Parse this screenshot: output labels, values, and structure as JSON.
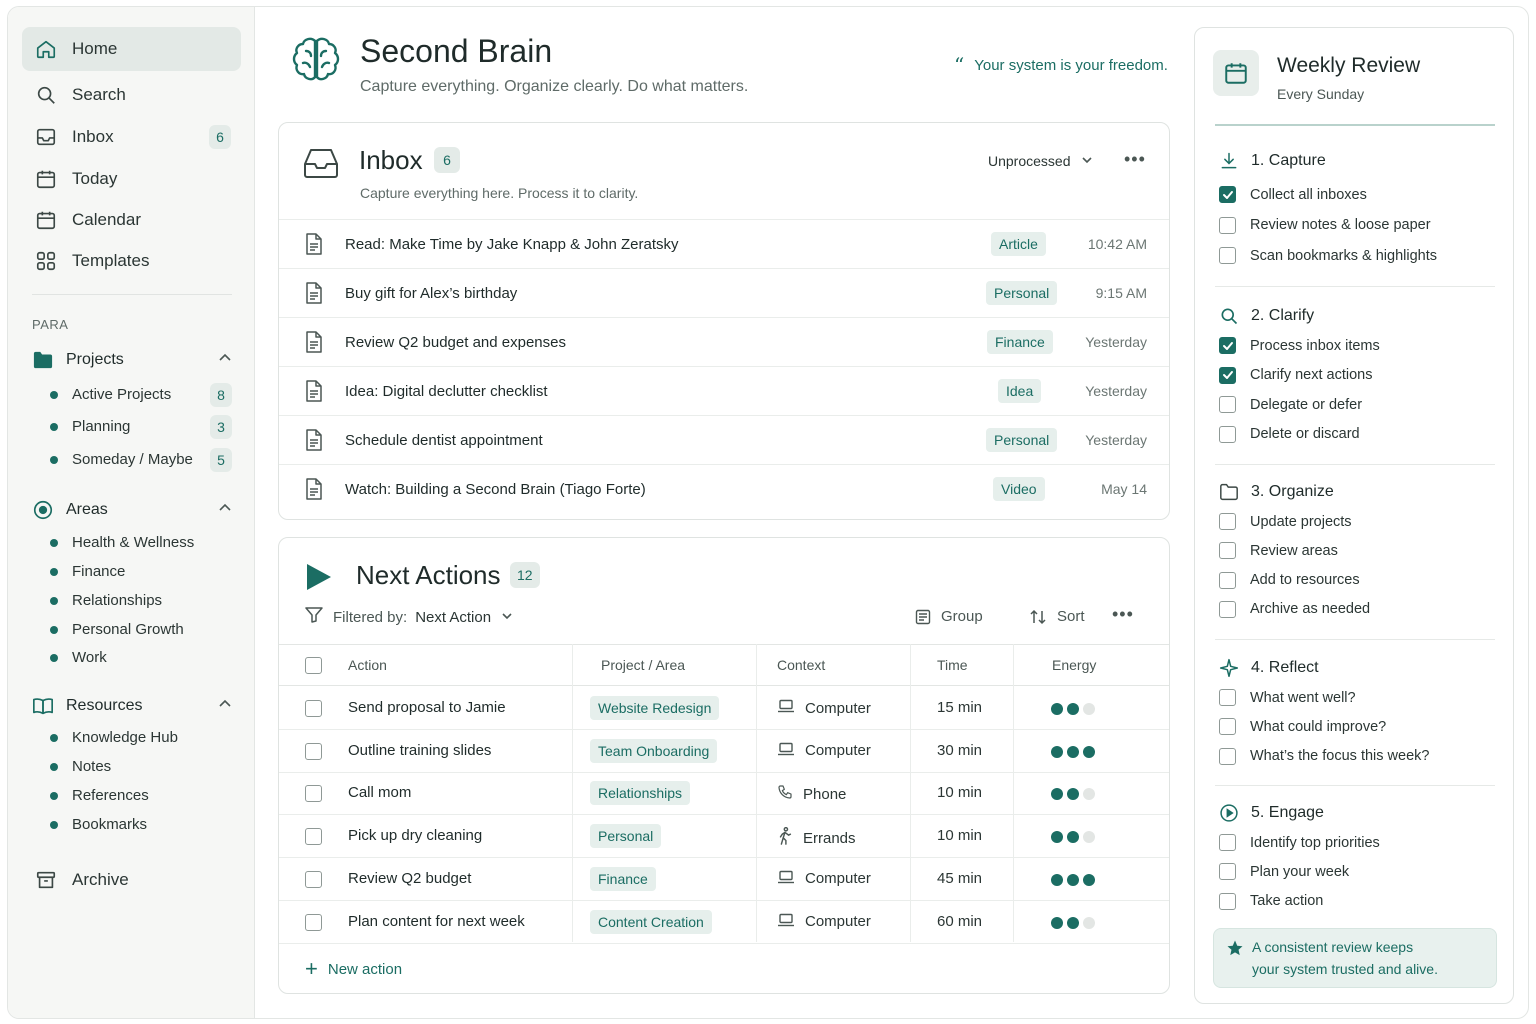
{
  "sidebar": {
    "nav": [
      {
        "label": "Home",
        "icon": "home-icon",
        "active": true
      },
      {
        "label": "Search",
        "icon": "search-icon"
      },
      {
        "label": "Inbox",
        "icon": "inbox-icon",
        "badge": "6"
      },
      {
        "label": "Today",
        "icon": "calendar-icon"
      },
      {
        "label": "Calendar",
        "icon": "calendar-icon"
      },
      {
        "label": "Templates",
        "icon": "grid-icon"
      }
    ],
    "section_label": "PARA",
    "projects": {
      "label": "Projects",
      "items": [
        {
          "label": "Active Projects",
          "badge": "8"
        },
        {
          "label": "Planning",
          "badge": "3"
        },
        {
          "label": "Someday / Maybe",
          "badge": "5"
        }
      ]
    },
    "areas": {
      "label": "Areas",
      "items": [
        {
          "label": "Health & Wellness"
        },
        {
          "label": "Finance"
        },
        {
          "label": "Relationships"
        },
        {
          "label": "Personal Growth"
        },
        {
          "label": "Work"
        }
      ]
    },
    "resources": {
      "label": "Resources",
      "items": [
        {
          "label": "Knowledge Hub"
        },
        {
          "label": "Notes"
        },
        {
          "label": "References"
        },
        {
          "label": "Bookmarks"
        }
      ]
    },
    "archive": "Archive"
  },
  "header": {
    "title": "Second Brain",
    "subtitle": "Capture everything. Organize clearly. Do what matters.",
    "quote": "Your system is your freedom.",
    "quote_mark": "“"
  },
  "inbox": {
    "title": "Inbox",
    "count": "6",
    "subtitle": "Capture everything here. Process it to clarity.",
    "filter": "Unprocessed",
    "more": "•••",
    "rows": [
      {
        "text": "Read: Make Time by Jake Knapp & John Zeratsky",
        "tag": "Article",
        "time": "10:42 AM"
      },
      {
        "text": "Buy gift for Alex’s birthday",
        "tag": "Personal",
        "time": "9:15 AM"
      },
      {
        "text": "Review Q2 budget and expenses",
        "tag": "Finance",
        "time": "Yesterday"
      },
      {
        "text": "Idea: Digital declutter checklist",
        "tag": "Idea",
        "time": "Yesterday"
      },
      {
        "text": "Schedule dentist appointment",
        "tag": "Personal",
        "time": "Yesterday"
      },
      {
        "text": "Watch: Building a Second Brain (Tiago Forte)",
        "tag": "Video",
        "time": "May 14"
      }
    ]
  },
  "next_actions": {
    "title": "Next Actions",
    "count": "12",
    "filter_label": "Filtered by:",
    "filter_value": "Next Action",
    "group_label": "Group",
    "sort_label": "Sort",
    "more": "•••",
    "columns": [
      "Action",
      "Project / Area",
      "Context",
      "Time",
      "Energy"
    ],
    "rows": [
      {
        "action": "Send proposal to Jamie",
        "project": "Website Redesign",
        "context": "Computer",
        "context_icon": "laptop-icon",
        "time": "15 min",
        "energy": 2
      },
      {
        "action": "Outline training slides",
        "project": "Team Onboarding",
        "context": "Computer",
        "context_icon": "laptop-icon",
        "time": "30 min",
        "energy": 3
      },
      {
        "action": "Call mom",
        "project": "Relationships",
        "context": "Phone",
        "context_icon": "phone-icon",
        "time": "10 min",
        "energy": 2
      },
      {
        "action": "Pick up dry cleaning",
        "project": "Personal",
        "context": "Errands",
        "context_icon": "walking-icon",
        "time": "10 min",
        "energy": 2
      },
      {
        "action": "Review Q2 budget",
        "project": "Finance",
        "context": "Computer",
        "context_icon": "laptop-icon",
        "time": "45 min",
        "energy": 3
      },
      {
        "action": "Plan content for next week",
        "project": "Content Creation",
        "context": "Computer",
        "context_icon": "laptop-icon",
        "time": "60 min",
        "energy": 2
      }
    ],
    "new_action": "New action",
    "accent": "#1b6d63"
  },
  "review": {
    "title": "Weekly Review",
    "subtitle": "Every Sunday",
    "steps": [
      {
        "label": "1. Capture",
        "icon": "download-icon",
        "items": [
          {
            "label": "Collect all inboxes",
            "checked": true
          },
          {
            "label": "Review notes & loose paper",
            "checked": false
          },
          {
            "label": "Scan bookmarks & highlights",
            "checked": false
          }
        ]
      },
      {
        "label": "2. Clarify",
        "icon": "search-icon",
        "items": [
          {
            "label": "Process inbox items",
            "checked": true
          },
          {
            "label": "Clarify next actions",
            "checked": true
          },
          {
            "label": "Delegate or defer",
            "checked": false
          },
          {
            "label": "Delete or discard",
            "checked": false
          }
        ]
      },
      {
        "label": "3. Organize",
        "icon": "folder-icon",
        "items": [
          {
            "label": "Update projects",
            "checked": false
          },
          {
            "label": "Review areas",
            "checked": false
          },
          {
            "label": "Add to resources",
            "checked": false
          },
          {
            "label": "Archive as needed",
            "checked": false
          }
        ]
      },
      {
        "label": "4. Reflect",
        "icon": "sparkle-icon",
        "items": [
          {
            "label": "What went well?",
            "checked": false
          },
          {
            "label": "What could improve?",
            "checked": false
          },
          {
            "label": "What’s the focus this week?",
            "checked": false
          }
        ]
      },
      {
        "label": "5. Engage",
        "icon": "play-circle-icon",
        "items": [
          {
            "label": "Identify top priorities",
            "checked": false
          },
          {
            "label": "Plan your week",
            "checked": false
          },
          {
            "label": "Take action",
            "checked": false
          }
        ]
      }
    ],
    "note_line1": "A consistent review keeps",
    "note_line2": "your system trusted and alive."
  }
}
